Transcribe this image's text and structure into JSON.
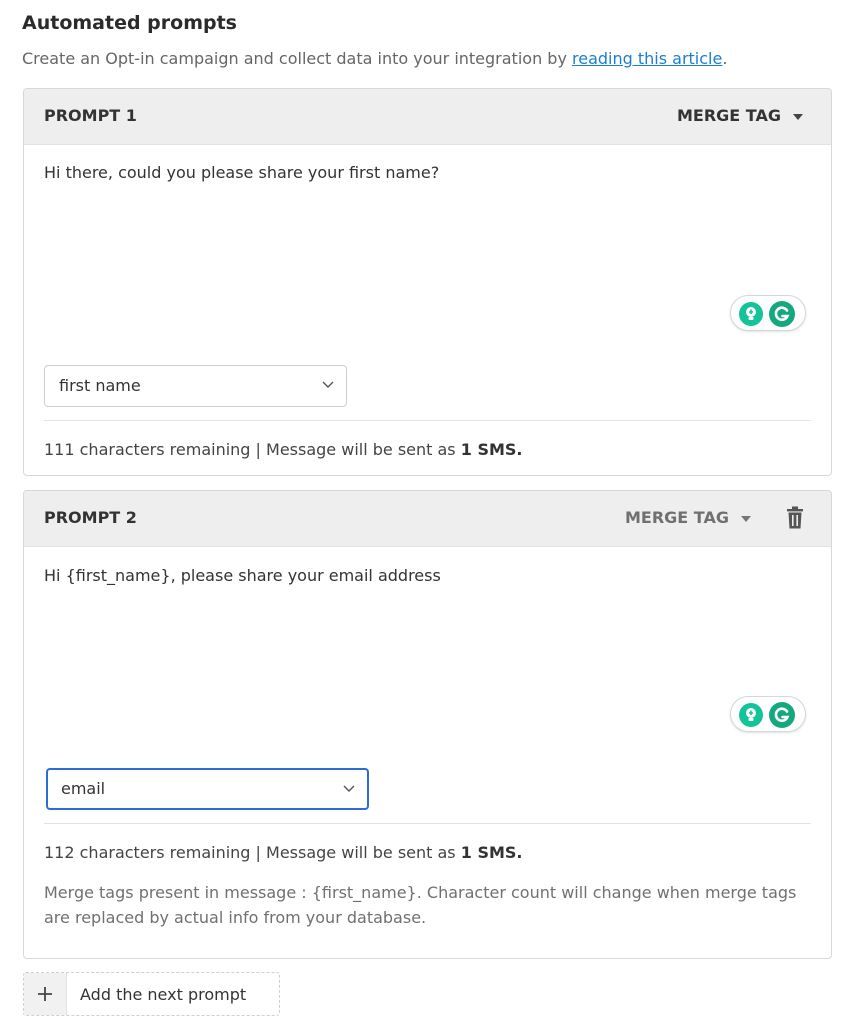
{
  "section": {
    "title": "Automated prompts",
    "description_prefix": "Create an Opt-in campaign and collect data into your integration by ",
    "link_text": "reading this article",
    "description_suffix": "."
  },
  "prompts": [
    {
      "title": "PROMPT 1",
      "merge_tag_label": "MERGE TAG",
      "message": "Hi there, could you please share your first name?",
      "field_value": "first name",
      "counter_text": "111 characters remaining | Message will be sent as ",
      "counter_bold": "1 SMS."
    },
    {
      "title": "PROMPT 2",
      "merge_tag_label": "MERGE TAG",
      "message": "Hi {first_name}, please share your email address",
      "field_value": "email",
      "counter_text": "112 characters remaining | Message will be sent as ",
      "counter_bold": "1 SMS.",
      "note": "Merge tags present in message : {first_name}. Character count will change when merge tags are replaced by actual info from your database."
    }
  ],
  "add_prompt": {
    "label": "Add the next prompt"
  },
  "icons": {
    "caret": "caret-down-icon",
    "trash": "trash-icon",
    "bulb": "lightbulb-icon",
    "grammarly": "grammarly-g-icon",
    "chevron": "chevron-down-icon",
    "plus": "plus-icon"
  },
  "colors": {
    "link": "#1a7fd1",
    "focus": "#2e6bd9",
    "grammarly": "#15c39a",
    "header_bg": "#eeeeee"
  }
}
